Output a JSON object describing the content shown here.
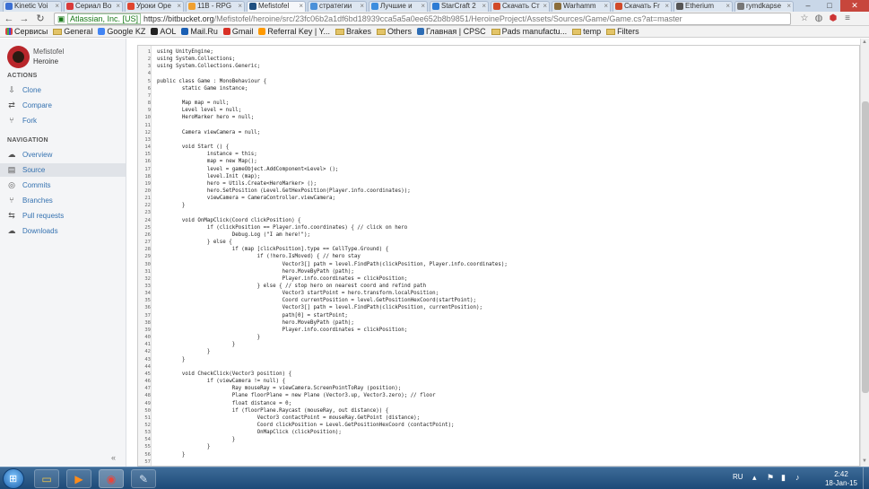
{
  "browser": {
    "tabs": [
      {
        "label": "Kinetic Voi",
        "favicon_color": "#3b6fd3",
        "active": false
      },
      {
        "label": "Сериал Во",
        "favicon_color": "#d93b3b",
        "active": false
      },
      {
        "label": "Уроки Оре",
        "favicon_color": "#e0452f",
        "active": false
      },
      {
        "label": "11B - RPG",
        "favicon_color": "#f0a030",
        "active": false
      },
      {
        "label": "Mefistofel",
        "favicon_color": "#205081",
        "active": true
      },
      {
        "label": "стратегии",
        "favicon_color": "#4a90d9",
        "active": false
      },
      {
        "label": "Лучшие и",
        "favicon_color": "#3c8dde",
        "active": false
      },
      {
        "label": "StarCraft 2",
        "favicon_color": "#2c7bd4",
        "active": false
      },
      {
        "label": "Скачать Ст",
        "favicon_color": "#d14a2a",
        "active": false
      },
      {
        "label": "Warhamm",
        "favicon_color": "#8a6d3b",
        "active": false
      },
      {
        "label": "Скачать Fr",
        "favicon_color": "#d14a2a",
        "active": false
      },
      {
        "label": "Etherium",
        "favicon_color": "#555555",
        "active": false
      },
      {
        "label": "rymdkapse",
        "favicon_color": "#777777",
        "active": false
      }
    ],
    "address": {
      "ev_label": "Atlassian, Inc. [US]",
      "url_prefix": "https://bitbucket.org",
      "url_path": "/Mefistofel/heroine/src/23fc06b2a1df6bd18939cca5a5a0ee652b8b9851/HeroineProject/Assets/Sources/Game/Game.cs?at=master"
    },
    "bookmarks": [
      {
        "label": "Сервисы",
        "type": "apps"
      },
      {
        "label": "General",
        "type": "folder"
      },
      {
        "label": "Google KZ",
        "type": "site",
        "color": "#4285f4"
      },
      {
        "label": "AOL",
        "type": "site",
        "color": "#222222"
      },
      {
        "label": "Mail.Ru",
        "type": "site",
        "color": "#1a5fb4"
      },
      {
        "label": "Gmail",
        "type": "site",
        "color": "#d93025"
      },
      {
        "label": "Referral Key | Y...",
        "type": "site",
        "color": "#ff9900"
      },
      {
        "label": "Brakes",
        "type": "folder"
      },
      {
        "label": "Others",
        "type": "folder"
      },
      {
        "label": "Главная | CPSC",
        "type": "site",
        "color": "#2d6db5"
      },
      {
        "label": "Pads manufactu...",
        "type": "folder"
      },
      {
        "label": "temp",
        "type": "folder"
      },
      {
        "label": "Filters",
        "type": "folder"
      }
    ]
  },
  "sidebar": {
    "owner": "Mefistofel",
    "repo": "Heroine",
    "actions_heading": "ACTIONS",
    "actions": [
      {
        "label": "Clone",
        "icon": "clone-icon",
        "glyph": "⇩"
      },
      {
        "label": "Compare",
        "icon": "compare-icon",
        "glyph": "⇄"
      },
      {
        "label": "Fork",
        "icon": "fork-icon",
        "glyph": "⑂"
      }
    ],
    "nav_heading": "NAVIGATION",
    "nav": [
      {
        "label": "Overview",
        "icon": "overview-icon",
        "glyph": "☁",
        "active": false
      },
      {
        "label": "Source",
        "icon": "source-icon",
        "glyph": "▤",
        "active": true
      },
      {
        "label": "Commits",
        "icon": "commits-icon",
        "glyph": "◎",
        "active": false
      },
      {
        "label": "Branches",
        "icon": "branches-icon",
        "glyph": "⑂",
        "active": false
      },
      {
        "label": "Pull requests",
        "icon": "pull-requests-icon",
        "glyph": "⇆",
        "active": false
      },
      {
        "label": "Downloads",
        "icon": "downloads-icon",
        "glyph": "☁",
        "active": false
      }
    ],
    "collapse_glyph": "«"
  },
  "code": {
    "lines": [
      "using UnityEngine;",
      "using System.Collections;",
      "using System.Collections.Generic;",
      "",
      "public class Game : MonoBehaviour {",
      "        static Game instance;",
      "",
      "        Map map = null;",
      "        Level level = null;",
      "        HeroMarker hero = null;",
      "",
      "        Camera viewCamera = null;",
      "",
      "        void Start () {",
      "                instance = this;",
      "                map = new Map();",
      "                level = gameObject.AddComponent<Level> ();",
      "                level.Init (map);",
      "                hero = Utils.Create<HeroMarker> ();",
      "                hero.SetPosition (Level.GetHexPosition(Player.info.coordinates));",
      "                viewCamera = CameraController.viewCamera;",
      "        }",
      "",
      "        void OnMapClick(Coord clickPosition) {",
      "                if (clickPosition == Player.info.coordinates) { // click on hero",
      "                        Debug.Log (\"I am here!\");",
      "                } else {",
      "                        if (map [clickPosition].type == CellType.Ground) {",
      "                                if (!hero.IsMoved) { // hero stay",
      "                                        Vector3[] path = level.FindPath(clickPosition, Player.info.coordinates);",
      "                                        hero.MoveByPath (path);",
      "                                        Player.info.coordinates = clickPosition;",
      "                                } else { // stop hero on nearest coord and refind path",
      "                                        Vector3 startPoint = hero.transform.localPosition;",
      "                                        Coord currentPosition = level.GetPositionHexCoord(startPoint);",
      "                                        Vector3[] path = level.FindPath(clickPosition, currentPosition);",
      "                                        path[0] = startPoint;",
      "                                        hero.MoveByPath (path);",
      "                                        Player.info.coordinates = clickPosition;",
      "                                }",
      "                        }",
      "                }",
      "        }",
      "",
      "        void CheckClick(Vector3 position) {",
      "                if (viewCamera != null) {",
      "                        Ray mouseRay = viewCamera.ScreenPointToRay (position);",
      "                        Plane floorPlane = new Plane (Vector3.up, Vector3.zero); // floor",
      "                        float distance = 0;",
      "                        if (floorPlane.Raycast (mouseRay, out distance)) {",
      "                                Vector3 contactPoint = mouseRay.GetPoint (distance);",
      "                                Coord clickPosition = Level.GetPositionHexCoord (contactPoint);",
      "                                OnMapClick (clickPosition);",
      "                        }",
      "                }",
      "        }",
      "",
      "        void Update() {"
    ]
  },
  "taskbar": {
    "apps": [
      {
        "name": "explorer-icon",
        "glyph": "▭",
        "color": "#f0c64a"
      },
      {
        "name": "media-player-icon",
        "glyph": "▶",
        "color": "#ff8c1a"
      },
      {
        "name": "chrome-icon",
        "glyph": "◉",
        "color": "#e8453c"
      },
      {
        "name": "tool-icon",
        "glyph": "✎",
        "color": "#d7e4f2"
      }
    ],
    "language": "RU",
    "time": "2:42",
    "date": "18-Jan-15"
  }
}
